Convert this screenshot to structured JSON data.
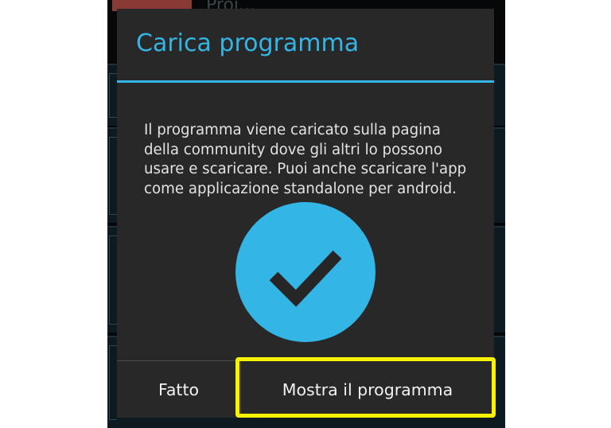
{
  "background_app": {
    "header_partial_text": "Proj..."
  },
  "dialog": {
    "title": "Carica programma",
    "message": "Il programma viene caricato sulla pagina della community dove gli altri lo possono usare e scaricare. Puoi anche scaricare l'app come applicazione standalone per android.",
    "icon": "checkmark-circle-icon",
    "buttons": {
      "done_label": "Fatto",
      "show_label": "Mostra il programma"
    }
  },
  "colors": {
    "accent": "#33b5e5",
    "dialog_background": "#282828",
    "highlight": "#f6f200"
  }
}
